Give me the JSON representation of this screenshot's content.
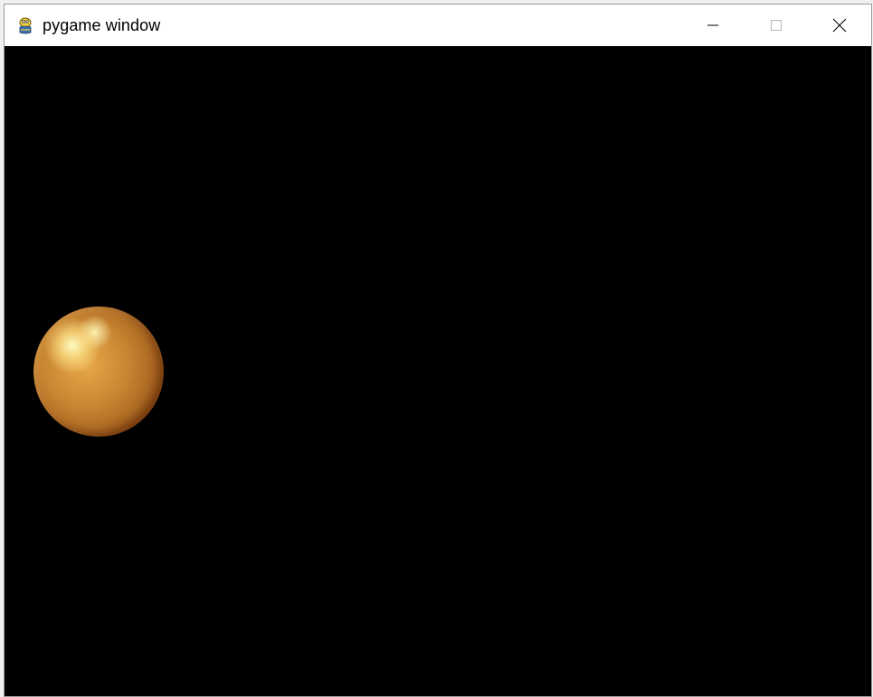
{
  "window": {
    "title": "pygame window",
    "controls": {
      "minimize_icon": "minimize-icon",
      "maximize_icon": "maximize-icon",
      "close_icon": "close-icon"
    }
  },
  "game": {
    "background_color": "#000000",
    "ball_color": "#c98531",
    "ball_highlight_color": "#fff6b0"
  }
}
